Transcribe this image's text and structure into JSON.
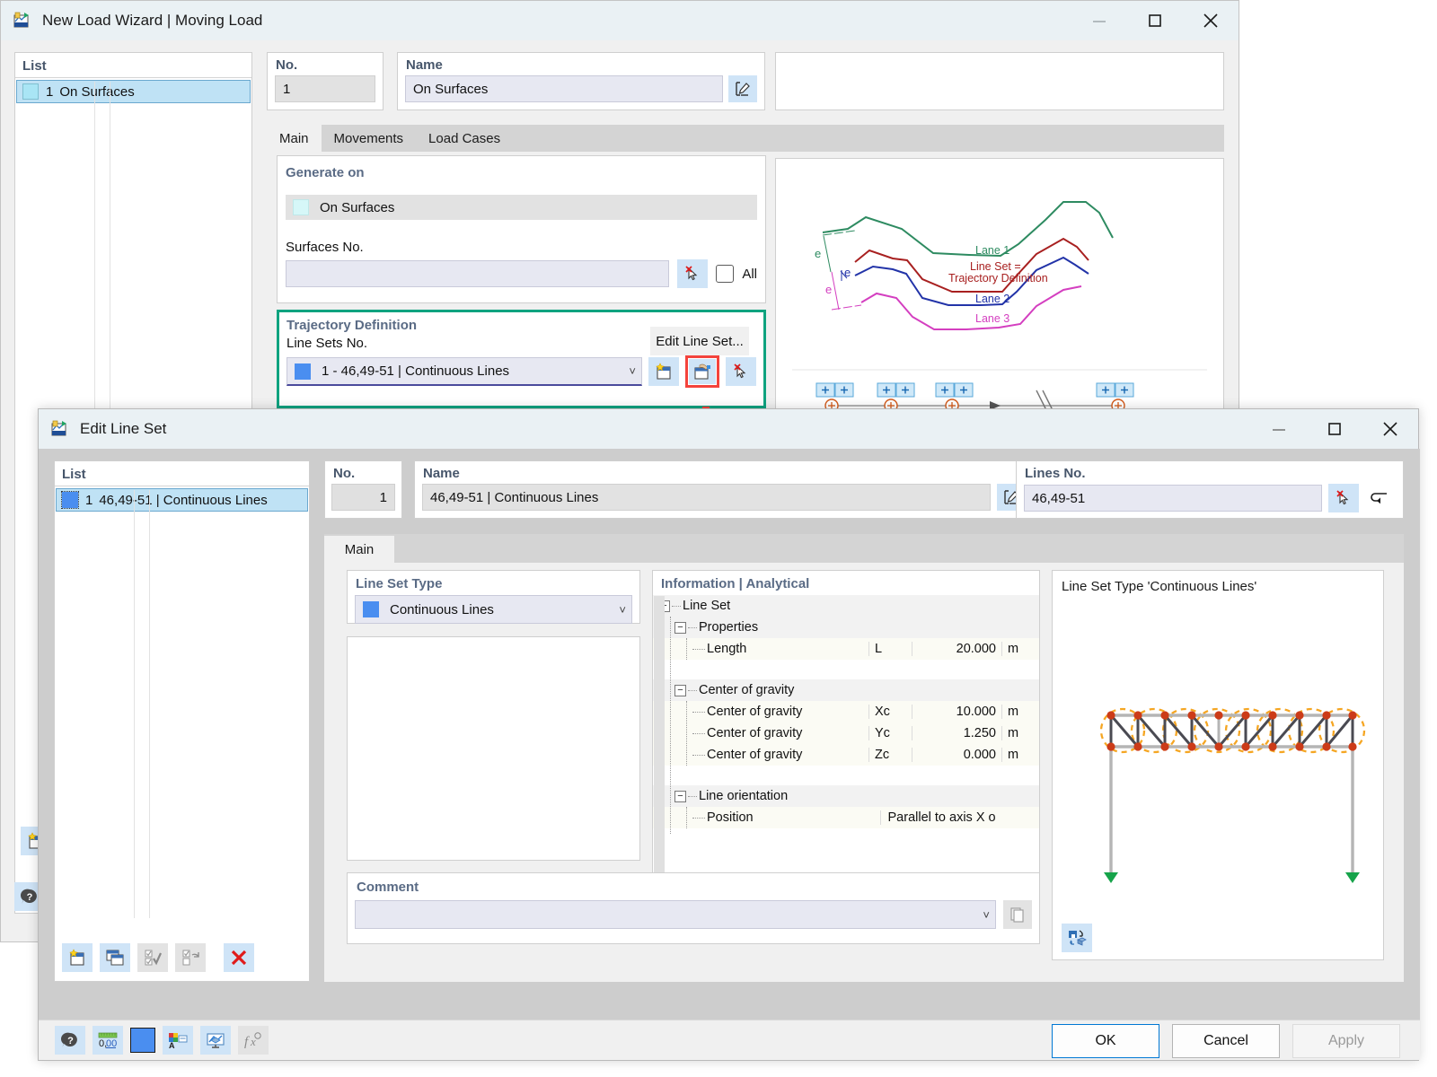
{
  "wizard": {
    "title": "New Load Wizard | Moving Load",
    "icon": "rfem-app-icon",
    "window_controls": {
      "minimize": "—",
      "maximize": "□",
      "close": "✕"
    },
    "list": {
      "header": "List",
      "items": [
        {
          "no": "1",
          "label": "On Surfaces",
          "color": "#a9e5f5"
        }
      ]
    },
    "no": {
      "label": "No.",
      "value": "1"
    },
    "name": {
      "label": "Name",
      "value": "On Surfaces",
      "edit_icon": "name-edit-icon"
    },
    "tabs": [
      {
        "label": "Main",
        "active": true
      },
      {
        "label": "Movements",
        "active": false
      },
      {
        "label": "Load Cases",
        "active": false
      }
    ],
    "generate_on": {
      "title": "Generate on",
      "selected": "On Surfaces",
      "selected_color": "#d6f7f8",
      "surfaces_label": "Surfaces No.",
      "surfaces_value": "",
      "pick_icon": "pick-cursor-icon",
      "all_label": "All",
      "all_checked": false
    },
    "trajectory": {
      "title": "Trajectory Definition",
      "line_sets_label": "Line Sets No.",
      "edit_button": "Edit Line Set...",
      "selected": "1 - 46,49-51 | Continuous Lines",
      "selected_color": "#4a8ef0",
      "new_icon": "new-line-set-icon",
      "edit_icon": "edit-line-set-icon",
      "pick_icon": "pick-cursor-icon"
    },
    "diagram": {
      "lanes": [
        {
          "label": "Lane 1",
          "color": "#2e8b61"
        },
        {
          "label": "Lane 2",
          "color": "#2233a8"
        },
        {
          "label": "Lane 3",
          "color": "#d43fc0"
        }
      ],
      "center_label_line1": "Line Set =",
      "center_label_line2": "Trajectory Definition",
      "center_color": "#a82020",
      "offset_labels": [
        "e",
        "e",
        "e"
      ]
    },
    "side_icons": [
      {
        "name": "new-item-icon"
      },
      {
        "name": "help-icon"
      }
    ]
  },
  "lineset": {
    "title": "Edit Line Set",
    "icon": "rfem-app-icon",
    "window_controls": {
      "minimize": "—",
      "maximize": "□",
      "close": "✕"
    },
    "list": {
      "header": "List",
      "items": [
        {
          "no": "1",
          "label": "46,49-51 | Continuous Lines",
          "color": "#4a8ef0"
        }
      ],
      "toolbar": [
        {
          "name": "new-line-set-icon"
        },
        {
          "name": "copy-line-set-icon"
        },
        {
          "name": "select-all-icon"
        },
        {
          "name": "invert-selection-icon"
        },
        {
          "name": "delete-icon"
        }
      ]
    },
    "no": {
      "label": "No.",
      "value": "1"
    },
    "name": {
      "label": "Name",
      "value": "46,49-51 | Continuous Lines",
      "edit_icon": "name-edit-icon"
    },
    "lines_no": {
      "label": "Lines No.",
      "value": "46,49-51",
      "pick_icon": "pick-cursor-icon",
      "back_icon": "arrow-back-icon"
    },
    "tabs": [
      {
        "label": "Main",
        "active": true
      }
    ],
    "line_set_type": {
      "title": "Line Set Type",
      "value": "Continuous Lines",
      "color": "#4a8ef0"
    },
    "information": {
      "title": "Information | Analytical",
      "rows": [
        {
          "kind": "group",
          "indent": 0,
          "expander": "−",
          "name": "Line Set",
          "symbol": "",
          "value": "",
          "unit": ""
        },
        {
          "kind": "group",
          "indent": 1,
          "expander": "−",
          "name": "Properties",
          "symbol": "",
          "value": "",
          "unit": ""
        },
        {
          "kind": "leaf",
          "indent": 2,
          "expander": "",
          "name": "Length",
          "symbol": "L",
          "value": "20.000",
          "unit": "m"
        },
        {
          "kind": "blank",
          "indent": 0,
          "expander": "",
          "name": "",
          "symbol": "",
          "value": "",
          "unit": ""
        },
        {
          "kind": "group",
          "indent": 1,
          "expander": "−",
          "name": "Center of gravity",
          "symbol": "",
          "value": "",
          "unit": ""
        },
        {
          "kind": "leaf",
          "indent": 2,
          "expander": "",
          "name": "Center of gravity",
          "symbol": "Xc",
          "value": "10.000",
          "unit": "m"
        },
        {
          "kind": "leaf",
          "indent": 2,
          "expander": "",
          "name": "Center of gravity",
          "symbol": "Yc",
          "value": "1.250",
          "unit": "m"
        },
        {
          "kind": "leaf",
          "indent": 2,
          "expander": "",
          "name": "Center of gravity",
          "symbol": "Zc",
          "value": "0.000",
          "unit": "m"
        },
        {
          "kind": "blank",
          "indent": 0,
          "expander": "",
          "name": "",
          "symbol": "",
          "value": "",
          "unit": ""
        },
        {
          "kind": "group",
          "indent": 1,
          "expander": "−",
          "name": "Line orientation",
          "symbol": "",
          "value": "",
          "unit": ""
        },
        {
          "kind": "leaf",
          "indent": 2,
          "expander": "",
          "name": "Position",
          "symbol": "",
          "value": "Parallel to axis X o",
          "unit": ""
        }
      ]
    },
    "preview": {
      "title": "Line Set Type 'Continuous Lines'",
      "view_icon": "view-rotate-icon",
      "member_color": "#4a4a52",
      "node_color": "#cc3b18",
      "highlight_color": "#f5a623",
      "support_color": "#1aa04a"
    },
    "comment": {
      "label": "Comment",
      "value": "",
      "copy_icon": "copy-comment-icon"
    },
    "bottom_toolbar": [
      {
        "name": "help-info-icon"
      },
      {
        "name": "decimal-places-icon"
      },
      {
        "name": "color-swatch-icon",
        "color": "#4a8ef0"
      },
      {
        "name": "display-properties-icon"
      },
      {
        "name": "screen-settings-icon"
      },
      {
        "name": "formula-icon",
        "disabled": true
      }
    ],
    "buttons": {
      "ok": "OK",
      "cancel": "Cancel",
      "apply": "Apply",
      "apply_disabled": true
    }
  }
}
